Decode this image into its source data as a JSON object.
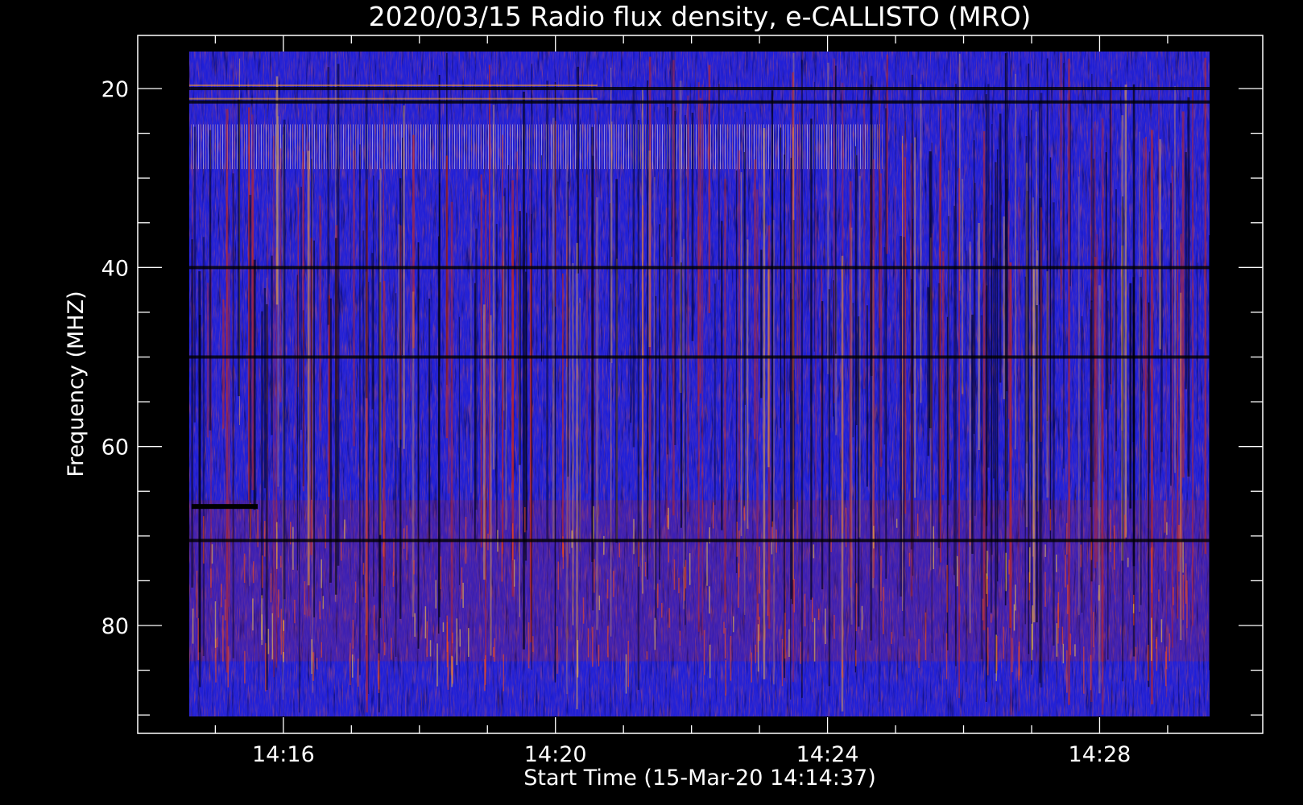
{
  "chart_data": {
    "type": "heatmap",
    "title": "2020/03/15  Radio flux density, e-CALLISTO (MRO)",
    "xlabel": "Start Time (15-Mar-20 14:14:37)",
    "ylabel": "Frequency (MHZ)",
    "x_range": [
      "14:14:37",
      "14:29:37"
    ],
    "y_range_mhz": [
      16,
      90
    ],
    "y_reversed": true,
    "x_ticks": [
      "14:16",
      "14:20",
      "14:24",
      "14:28"
    ],
    "y_ticks": [
      20,
      40,
      60,
      80
    ],
    "grid": false,
    "colormap": [
      "#000000",
      "#0a0a7a",
      "#2020e0",
      "#c02010",
      "#ff6010",
      "#ffd040"
    ],
    "features": {
      "rfi_bands_mhz": [
        20,
        21.5,
        40,
        50,
        70.5
      ],
      "bright_band_mhz": [
        24,
        29
      ],
      "enhanced_band_mhz": [
        66,
        84
      ]
    }
  }
}
